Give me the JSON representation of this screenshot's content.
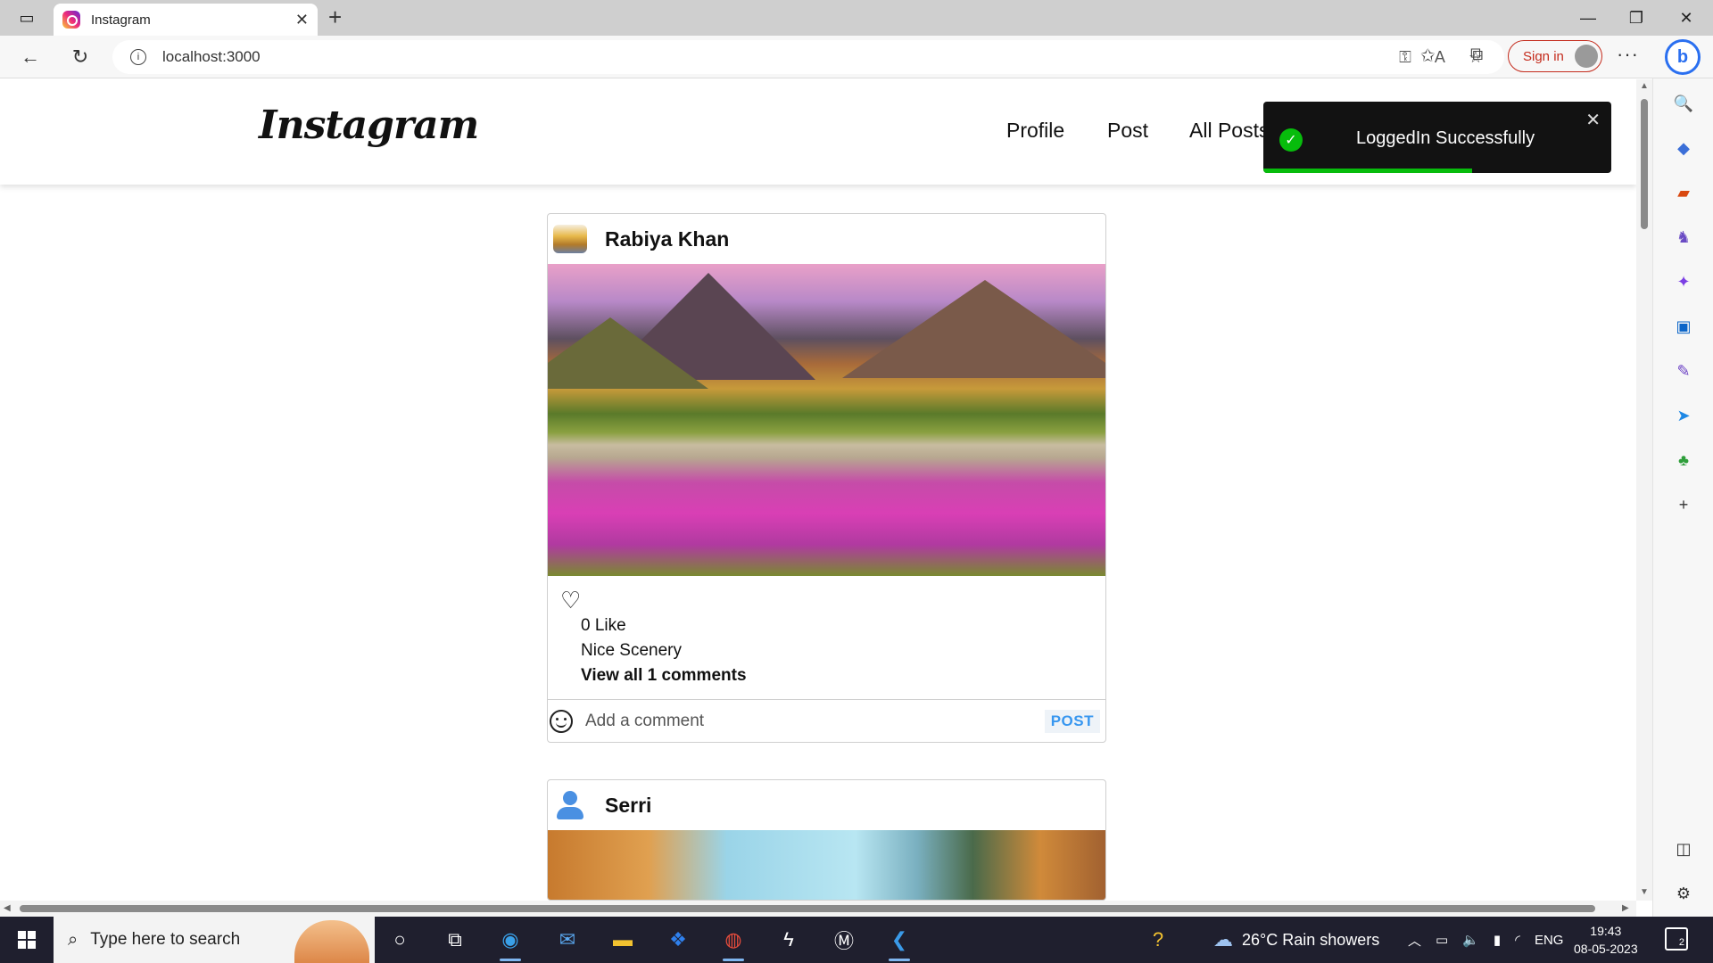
{
  "browser": {
    "tab_title": "Instagram",
    "url": "localhost:3000",
    "sign_in_label": "Sign in"
  },
  "site": {
    "logo_text": "Instagram",
    "nav": [
      "Profile",
      "Post",
      "All Posts"
    ]
  },
  "toast": {
    "message": "LoggedIn Successfully",
    "progress_percent": 60,
    "status_color": "#07bc0c"
  },
  "posts": [
    {
      "username": "Rabiya Khan",
      "avatar": "landscape-thumbnail",
      "image": "mountain-flower-meadow",
      "likes": "0 Like",
      "caption": "Nice Scenery",
      "comments_link": "View all 1 comments",
      "comment_placeholder": "Add a comment",
      "post_button": "POST"
    },
    {
      "username": "Serri",
      "avatar": "default-user-icon",
      "image": "autumn-trees-sky"
    }
  ],
  "taskbar": {
    "search_placeholder": "Type here to search",
    "weather": "26°C  Rain showers",
    "language": "ENG",
    "time": "19:43",
    "date": "08-05-2023",
    "notification_count": "2"
  }
}
